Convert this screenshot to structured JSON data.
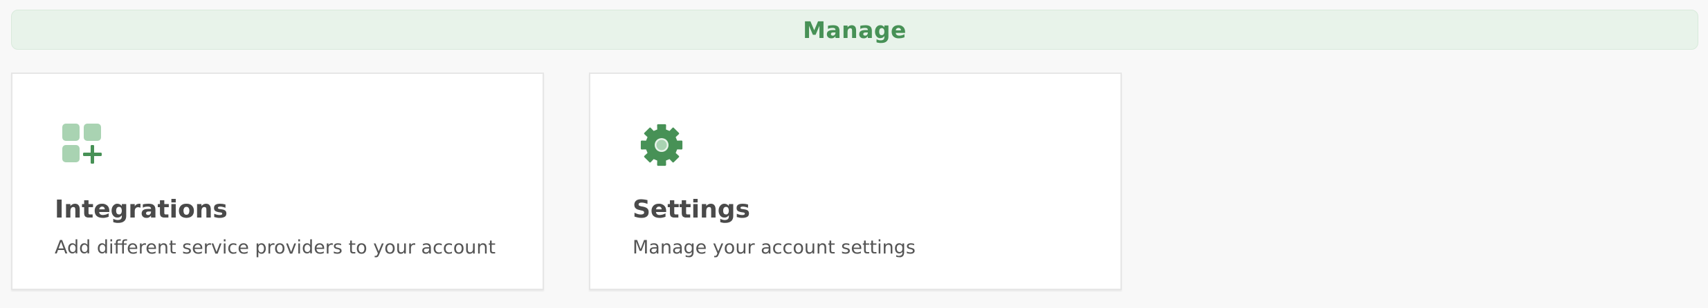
{
  "section": {
    "title": "Manage"
  },
  "cards": [
    {
      "icon": "integrations-add-icon",
      "title": "Integrations",
      "description": "Add different service providers to your account"
    },
    {
      "icon": "gear-icon",
      "title": "Settings",
      "description": "Manage your account settings"
    }
  ],
  "colors": {
    "accent": "#479156",
    "accent_light": "#a9d3b2",
    "header_bg": "#e8f3ea",
    "page_bg": "#f8f8f8",
    "title_text": "#4a4a4a",
    "body_text": "#555555"
  }
}
